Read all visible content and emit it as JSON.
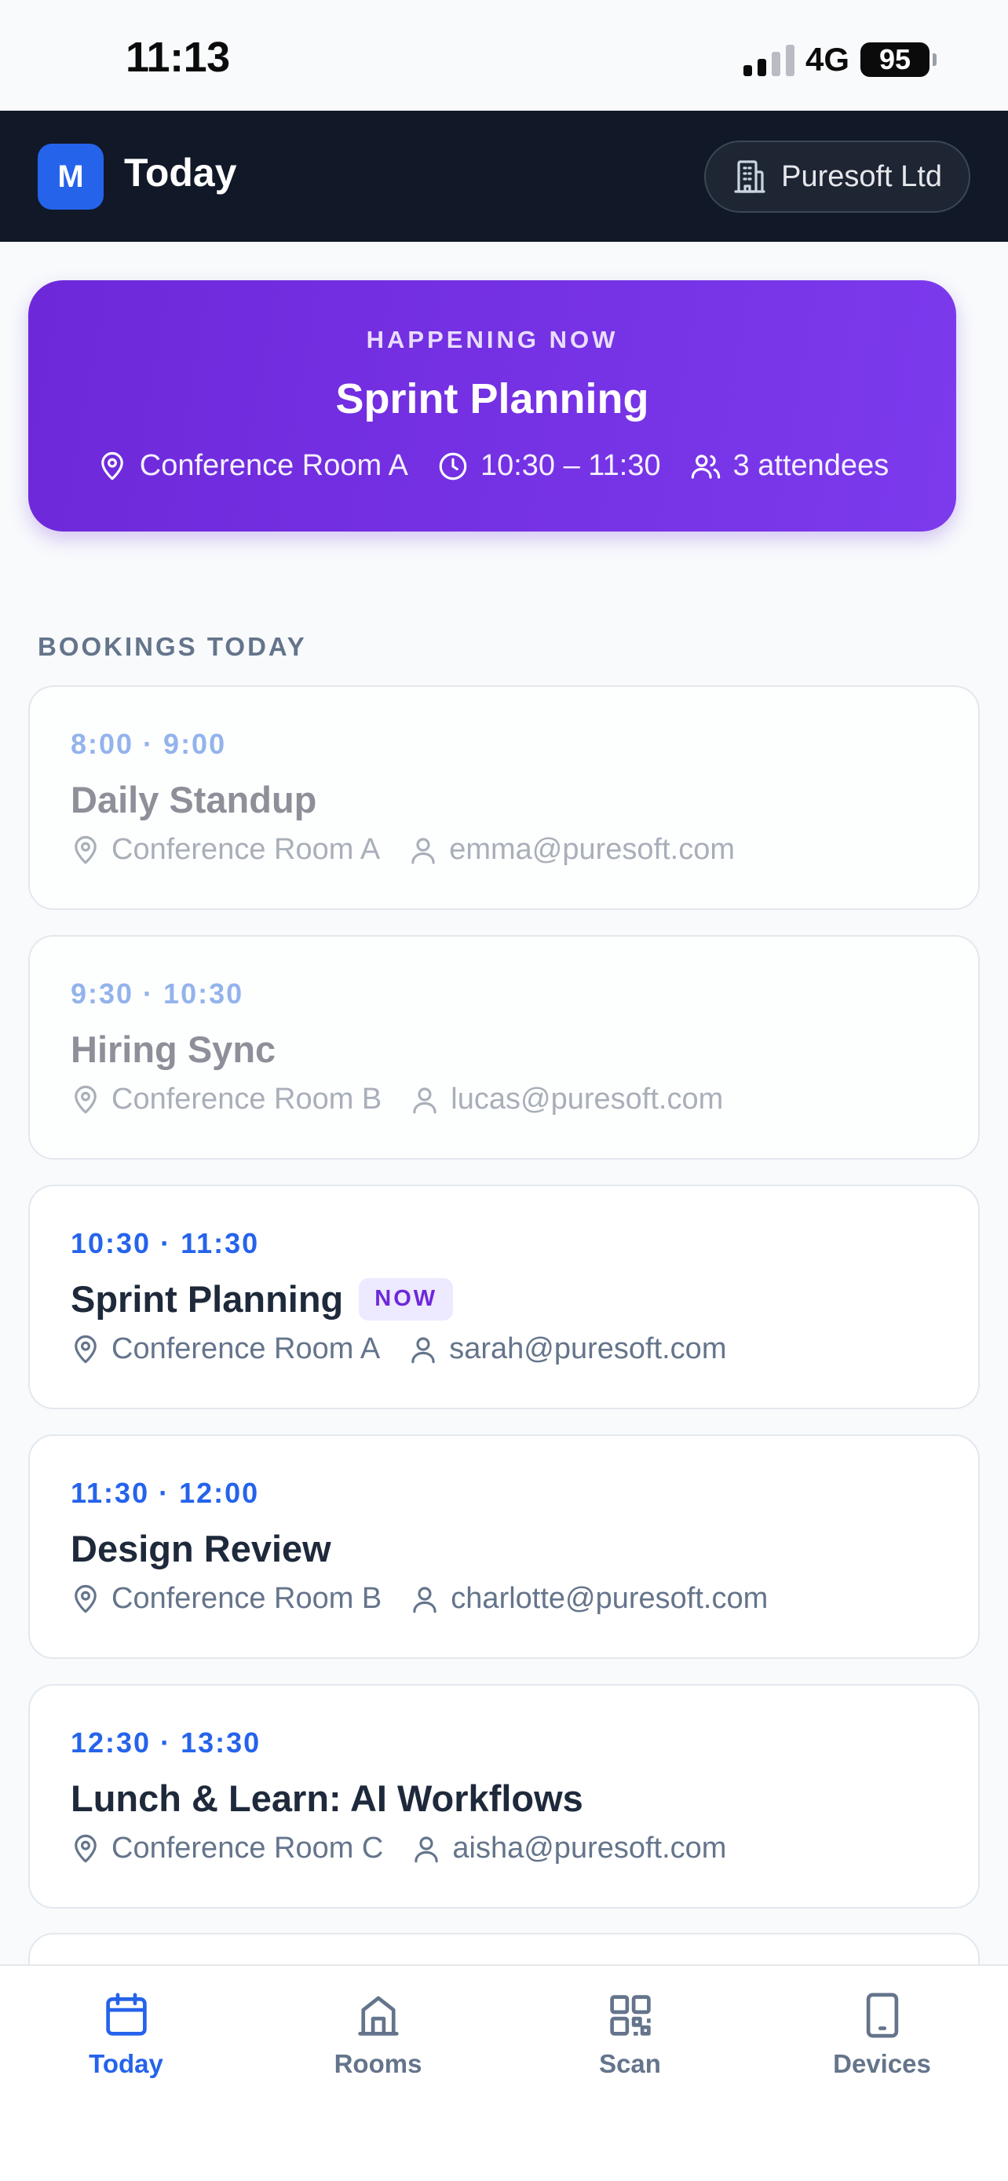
{
  "status_bar": {
    "time": "11:13",
    "network": "4G",
    "battery": "95"
  },
  "header": {
    "logo_letter": "M",
    "title": "Today",
    "org_name": "Puresoft Ltd"
  },
  "happening_now": {
    "label": "HAPPENING NOW",
    "title": "Sprint Planning",
    "room": "Conference Room A",
    "time": "10:30 – 11:30",
    "attendees": "3 attendees"
  },
  "bookings_section": {
    "label": "BOOKINGS TODAY"
  },
  "bookings": [
    {
      "time": "8:00 · 9:00",
      "title": "Daily Standup",
      "room": "Conference Room A",
      "organizer": "emma@puresoft.com",
      "status": "past"
    },
    {
      "time": "9:30 · 10:30",
      "title": "Hiring Sync",
      "room": "Conference Room B",
      "organizer": "lucas@puresoft.com",
      "status": "past"
    },
    {
      "time": "10:30 · 11:30",
      "title": "Sprint Planning",
      "badge": "NOW",
      "room": "Conference Room A",
      "organizer": "sarah@puresoft.com",
      "status": "current"
    },
    {
      "time": "11:30 · 12:00",
      "title": "Design Review",
      "room": "Conference Room B",
      "organizer": "charlotte@puresoft.com",
      "status": "upcoming"
    },
    {
      "time": "12:30 · 13:30",
      "title": "Lunch & Learn: AI Workflows",
      "room": "Conference Room C",
      "organizer": "aisha@puresoft.com",
      "status": "upcoming"
    }
  ],
  "tabs": [
    {
      "label": "Today",
      "icon": "calendar-icon",
      "active": true
    },
    {
      "label": "Rooms",
      "icon": "building-icon",
      "active": false
    },
    {
      "label": "Scan",
      "icon": "qr-code-icon",
      "active": false
    },
    {
      "label": "Devices",
      "icon": "tablet-icon",
      "active": false
    }
  ],
  "colors": {
    "accent": "#2563eb",
    "header_bg": "#111827",
    "now_card_bg": "#7c3aed",
    "now_badge_bg": "#ede9fe"
  }
}
